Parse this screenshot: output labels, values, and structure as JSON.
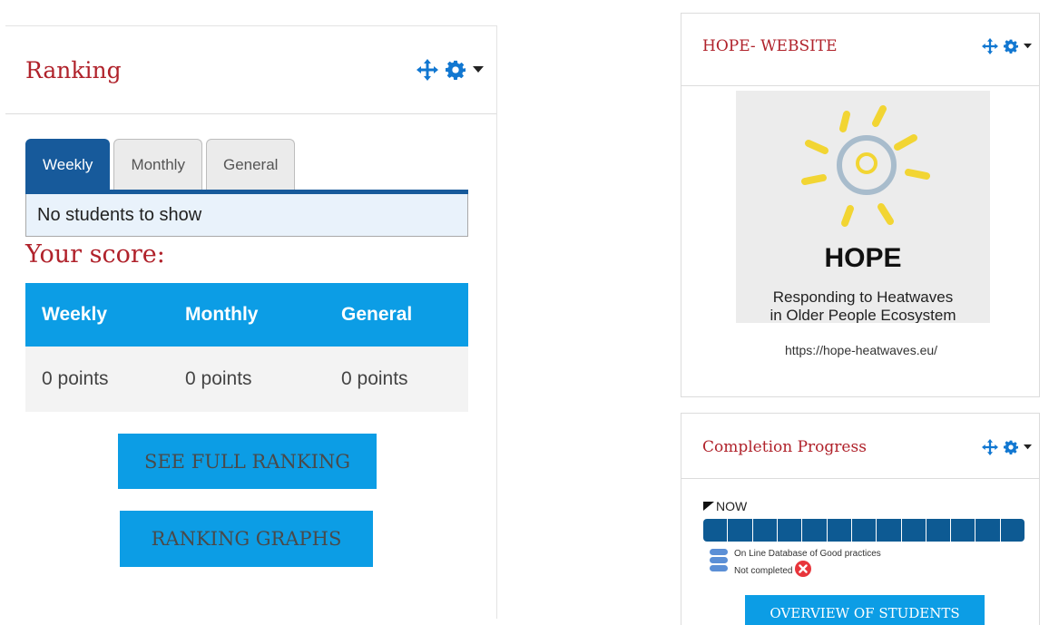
{
  "ranking": {
    "title": "Ranking",
    "tabs": [
      {
        "label": "Weekly"
      },
      {
        "label": "Monthly"
      },
      {
        "label": "General"
      }
    ],
    "empty_message": "No students to show",
    "your_score_label": "Your score:",
    "score_headers": [
      "Weekly",
      "Monthly",
      "General"
    ],
    "score_values": [
      "0 points",
      "0 points",
      "0 points"
    ],
    "see_full_label": "SEE FULL RANKING",
    "graphs_label": "RANKING GRAPHS"
  },
  "hope": {
    "title": "HOPE- WEBSITE",
    "logo_word": "HOPE",
    "logo_sub1": "Responding to Heatwaves",
    "logo_sub2": "in Older People Ecosystem",
    "url": "https://hope-heatwaves.eu/"
  },
  "completion": {
    "title": "Completion Progress",
    "now_label": "NOW",
    "progress_cells": 13,
    "activity_name": "On Line Database of Good practices",
    "activity_status": "Not completed",
    "overview_label": "OVERVIEW OF STUDENTS"
  },
  "colors": {
    "title_red": "#b0222b",
    "accent_blue": "#0c9de5",
    "tab_blue": "#175a9b",
    "progress_blue": "#0d5a93",
    "icon_blue": "#1177d1"
  }
}
